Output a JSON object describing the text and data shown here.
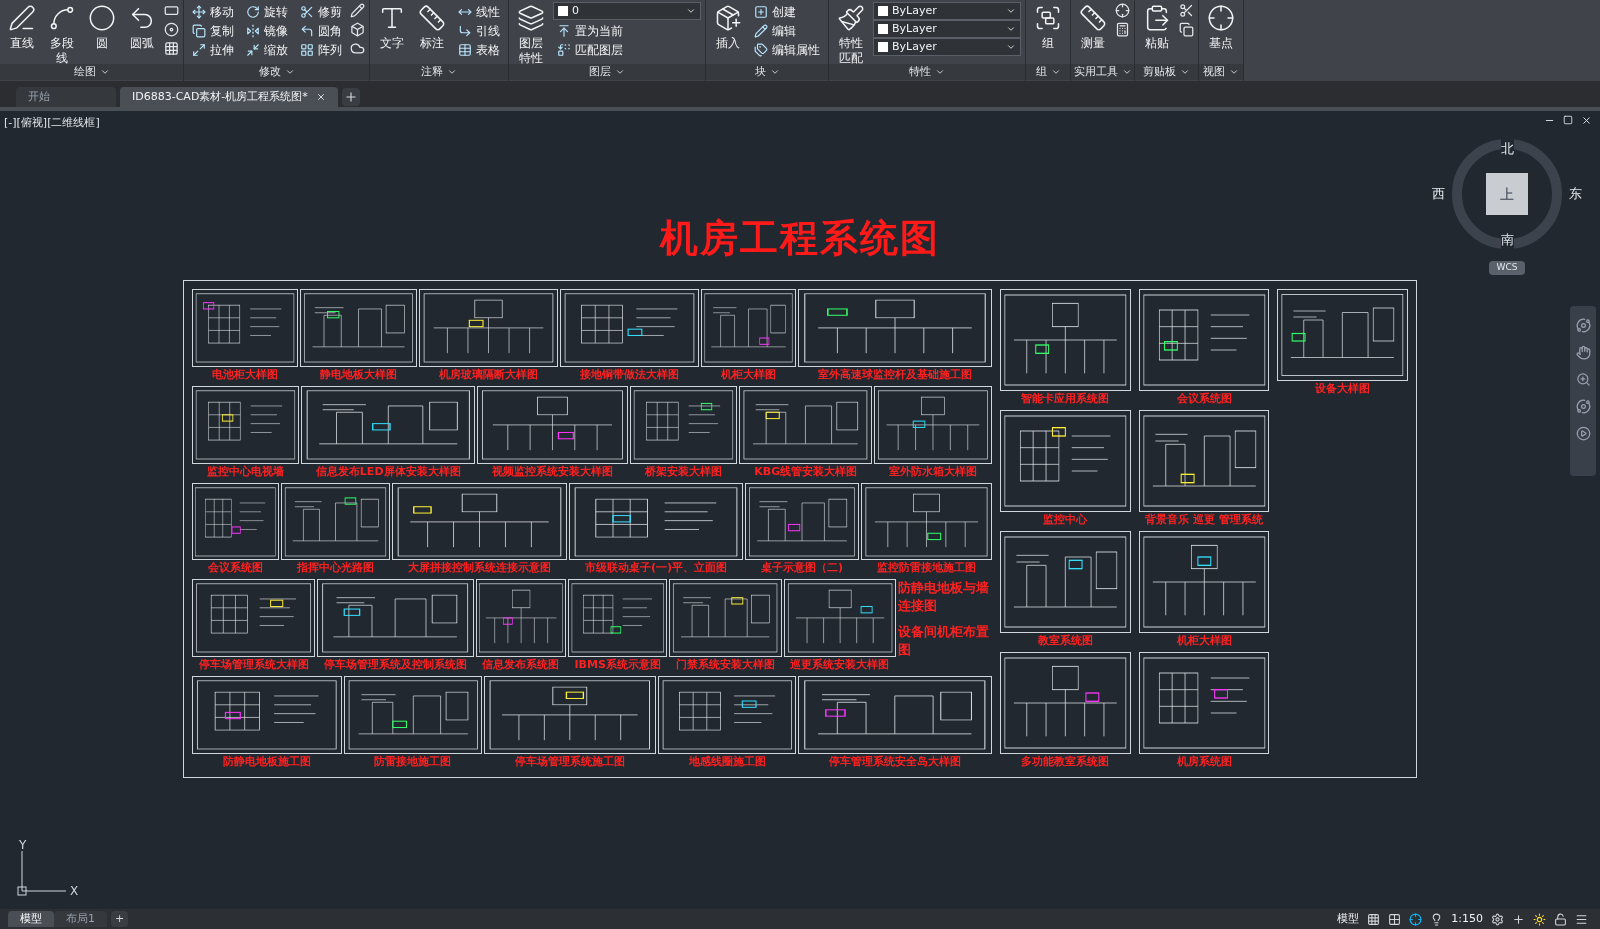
{
  "ribbon": {
    "panels": [
      {
        "title": "绘图",
        "tools": [
          {
            "kind": "large",
            "label": "直线"
          },
          {
            "kind": "large",
            "label": "多段线"
          },
          {
            "kind": "large",
            "label": "圆"
          },
          {
            "kind": "large",
            "label": "圆弧"
          }
        ]
      },
      {
        "title": "修改",
        "tools": [
          {
            "kind": "small",
            "label": "移动"
          },
          {
            "kind": "small",
            "label": "复制"
          },
          {
            "kind": "small",
            "label": "拉伸"
          },
          {
            "kind": "small",
            "label": "旋转"
          },
          {
            "kind": "small",
            "label": "镜像"
          },
          {
            "kind": "small",
            "label": "缩放"
          },
          {
            "kind": "small",
            "label": "修剪"
          },
          {
            "kind": "small",
            "label": "圆角"
          },
          {
            "kind": "small",
            "label": "阵列"
          }
        ]
      },
      {
        "title": "注释",
        "tools": [
          {
            "kind": "large",
            "label": "文字"
          },
          {
            "kind": "large",
            "label": "标注"
          },
          {
            "kind": "small",
            "label": "线性"
          },
          {
            "kind": "small",
            "label": "引线"
          },
          {
            "kind": "small",
            "label": "表格"
          }
        ]
      },
      {
        "title": "图层",
        "tools": [
          {
            "kind": "large",
            "label": "图层特性"
          },
          {
            "kind": "dropdown",
            "label": "0"
          },
          {
            "kind": "small",
            "label": "置为当前"
          },
          {
            "kind": "small",
            "label": "匹配图层"
          }
        ]
      },
      {
        "title": "块",
        "tools": [
          {
            "kind": "large",
            "label": "插入"
          },
          {
            "kind": "small",
            "label": "创建"
          },
          {
            "kind": "small",
            "label": "编辑"
          },
          {
            "kind": "small",
            "label": "编辑属性"
          }
        ]
      },
      {
        "title": "特性",
        "tools": [
          {
            "kind": "large",
            "label": "特性匹配"
          },
          {
            "kind": "dropdown",
            "label": "ByLayer"
          },
          {
            "kind": "dropdown",
            "label": "ByLayer"
          },
          {
            "kind": "dropdown",
            "label": "ByLayer"
          }
        ]
      },
      {
        "title": "组",
        "tools": [
          {
            "kind": "large",
            "label": "组"
          }
        ]
      },
      {
        "title": "实用工具",
        "tools": [
          {
            "kind": "large",
            "label": "测量"
          }
        ]
      },
      {
        "title": "剪贴板",
        "tools": [
          {
            "kind": "large",
            "label": "粘贴"
          }
        ]
      },
      {
        "title": "视图",
        "tools": [
          {
            "kind": "large",
            "label": "基点"
          }
        ]
      }
    ]
  },
  "tabs": [
    {
      "label": "开始",
      "selected": false
    },
    {
      "label": "ID6883-CAD素材-机房工程系统图*",
      "selected": true
    }
  ],
  "viewport": {
    "label": "[-][俯视][二维线框]",
    "viewcube": {
      "north": "北",
      "south": "南",
      "west": "西",
      "east": "东",
      "face": "上",
      "ucs": "WCS"
    },
    "ucs_axes": {
      "x": "X",
      "y": "Y"
    },
    "drawing": {
      "title": "机房工程系统图",
      "rows": [
        {
          "sheets": [
            {
              "label": "电池柜大样图"
            },
            {
              "label": "静电地板大样图"
            },
            {
              "label": "机房玻璃隔断大样图"
            },
            {
              "label": "接地铜带做法大样图"
            },
            {
              "label": "机柜大样图"
            },
            {
              "label": "室外高速球监控杆及基础施工图"
            }
          ]
        },
        {
          "sheets": [
            {
              "label": "监控中心电视墙"
            },
            {
              "label": "信息发布LED屏体安装大样图"
            },
            {
              "label": "视频监控系统安装大样图"
            },
            {
              "label": "桥架安装大样图"
            },
            {
              "label": "KBG线管安装大样图"
            },
            {
              "label": "室外防水箱大样图"
            }
          ]
        },
        {
          "sheets": [
            {
              "label": "会议系统图"
            },
            {
              "label": "指挥中心光路图"
            },
            {
              "label": "大屏拼接控制系统连接示意图"
            },
            {
              "label": "市级联动桌子(一)平、立面图"
            },
            {
              "label": "桌子示意图（二)"
            },
            {
              "label": "监控防雷接地施工图"
            }
          ]
        },
        {
          "sheets": [
            {
              "label": "停车场管理系统大样图"
            },
            {
              "label": "停车场管理系统及控制系统图"
            },
            {
              "label": "信息发布系统图"
            },
            {
              "label": "IBMS系统示意图"
            },
            {
              "label": "门禁系统安装大样图"
            },
            {
              "label": "巡更系统安装大样图"
            }
          ],
          "notes": [
            "防静电地板与墙连接图",
            "设备间机柜布置图"
          ]
        },
        {
          "sheets": [
            {
              "label": "防静电地板施工图"
            },
            {
              "label": "防雷接地施工图"
            },
            {
              "label": "停车场管理系统施工图"
            },
            {
              "label": "地感线圈施工图"
            },
            {
              "label": "停车管理系统安全岛大样图"
            }
          ]
        }
      ],
      "columns": [
        {
          "sheets": [
            {
              "label": "智能卡应用系统图"
            },
            {
              "label": "监控中心"
            },
            {
              "label": "教室系统图"
            },
            {
              "label": "多功能教室系统图"
            }
          ]
        },
        {
          "sheets": [
            {
              "label": "会议系统图"
            },
            {
              "label": "背景音乐  巡更  管理系统"
            },
            {
              "label": "机柜大样图"
            },
            {
              "label": "机房系统图"
            }
          ]
        },
        {
          "sheets": [
            {
              "label": "设备大样图"
            }
          ]
        }
      ]
    }
  },
  "status_bar": {
    "layouts": [
      {
        "label": "模型",
        "selected": true
      },
      {
        "label": "布局1",
        "selected": false
      }
    ],
    "add": "+",
    "space": "模型",
    "scale": "1:150"
  }
}
